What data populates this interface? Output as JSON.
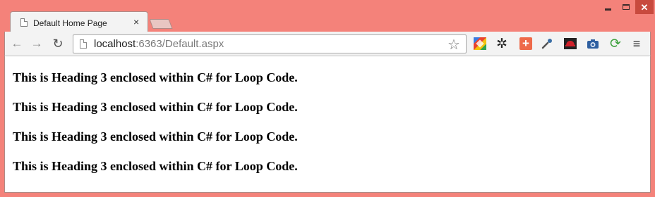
{
  "window": {
    "caption_buttons": [
      "minimize-icon",
      "maximize-icon",
      "close-icon"
    ],
    "frame_color": "#f4827a"
  },
  "tab": {
    "title": "Default Home Page",
    "close_glyph": "×"
  },
  "toolbar": {
    "back_glyph": "←",
    "forward_glyph": "→",
    "reload_glyph": "↻",
    "url_host": "localhost",
    "url_rest": ":6363/Default.aspx",
    "star_glyph": "☆",
    "plus_glyph": "+",
    "gear_glyph": "✲",
    "refresh_glyph": "⟳",
    "menu_glyph": "≡",
    "extensions": [
      "colors-icon",
      "gear-icon",
      "plus-icon",
      "eyedropper-icon",
      "redhat-icon",
      "camera-icon",
      "refresh-icon",
      "menu-icon"
    ]
  },
  "content": {
    "headings": [
      "This is Heading 3 enclosed within C# for Loop Code.",
      "This is Heading 3 enclosed within C# for Loop Code.",
      "This is Heading 3 enclosed within C# for Loop Code.",
      "This is Heading 3 enclosed within C# for Loop Code."
    ]
  }
}
